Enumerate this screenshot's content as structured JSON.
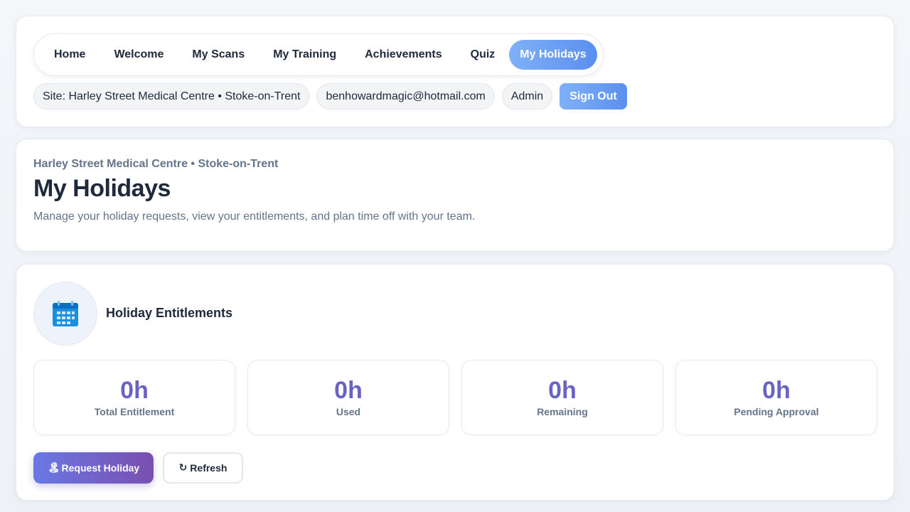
{
  "nav": {
    "items": [
      {
        "label": "Home",
        "active": false
      },
      {
        "label": "Welcome",
        "active": false
      },
      {
        "label": "My Scans",
        "active": false
      },
      {
        "label": "My Training",
        "active": false
      },
      {
        "label": "Achievements",
        "active": false
      },
      {
        "label": "Quiz",
        "active": false
      },
      {
        "label": "My Holidays",
        "active": true
      }
    ]
  },
  "meta": {
    "site": "Site: Harley Street Medical Centre • Stoke-on-Trent",
    "email": "benhowardmagic@hotmail.com",
    "role": "Admin",
    "sign_out_label": "Sign Out"
  },
  "page": {
    "site_subtitle": "Harley Street Medical Centre • Stoke-on-Trent",
    "title": "My Holidays",
    "description": "Manage your holiday requests, view your entitlements, and plan time off with your team."
  },
  "entitlements": {
    "icon": "calendar-icon",
    "title": "Holiday Entitlements",
    "stats": [
      {
        "value": "0h",
        "label": "Total Entitlement"
      },
      {
        "value": "0h",
        "label": "Used"
      },
      {
        "value": "0h",
        "label": "Remaining"
      },
      {
        "value": "0h",
        "label": "Pending Approval"
      }
    ],
    "request_button": {
      "icon": "🏝",
      "label": "Request Holiday"
    },
    "refresh_button": {
      "icon": "↻",
      "label": "Refresh"
    }
  },
  "colors": {
    "accent_blue": "#5b8ff0",
    "stat_purple": "#6a63c4",
    "primary_gradient_start": "#6a78e3",
    "primary_gradient_end": "#7a4fb0"
  }
}
